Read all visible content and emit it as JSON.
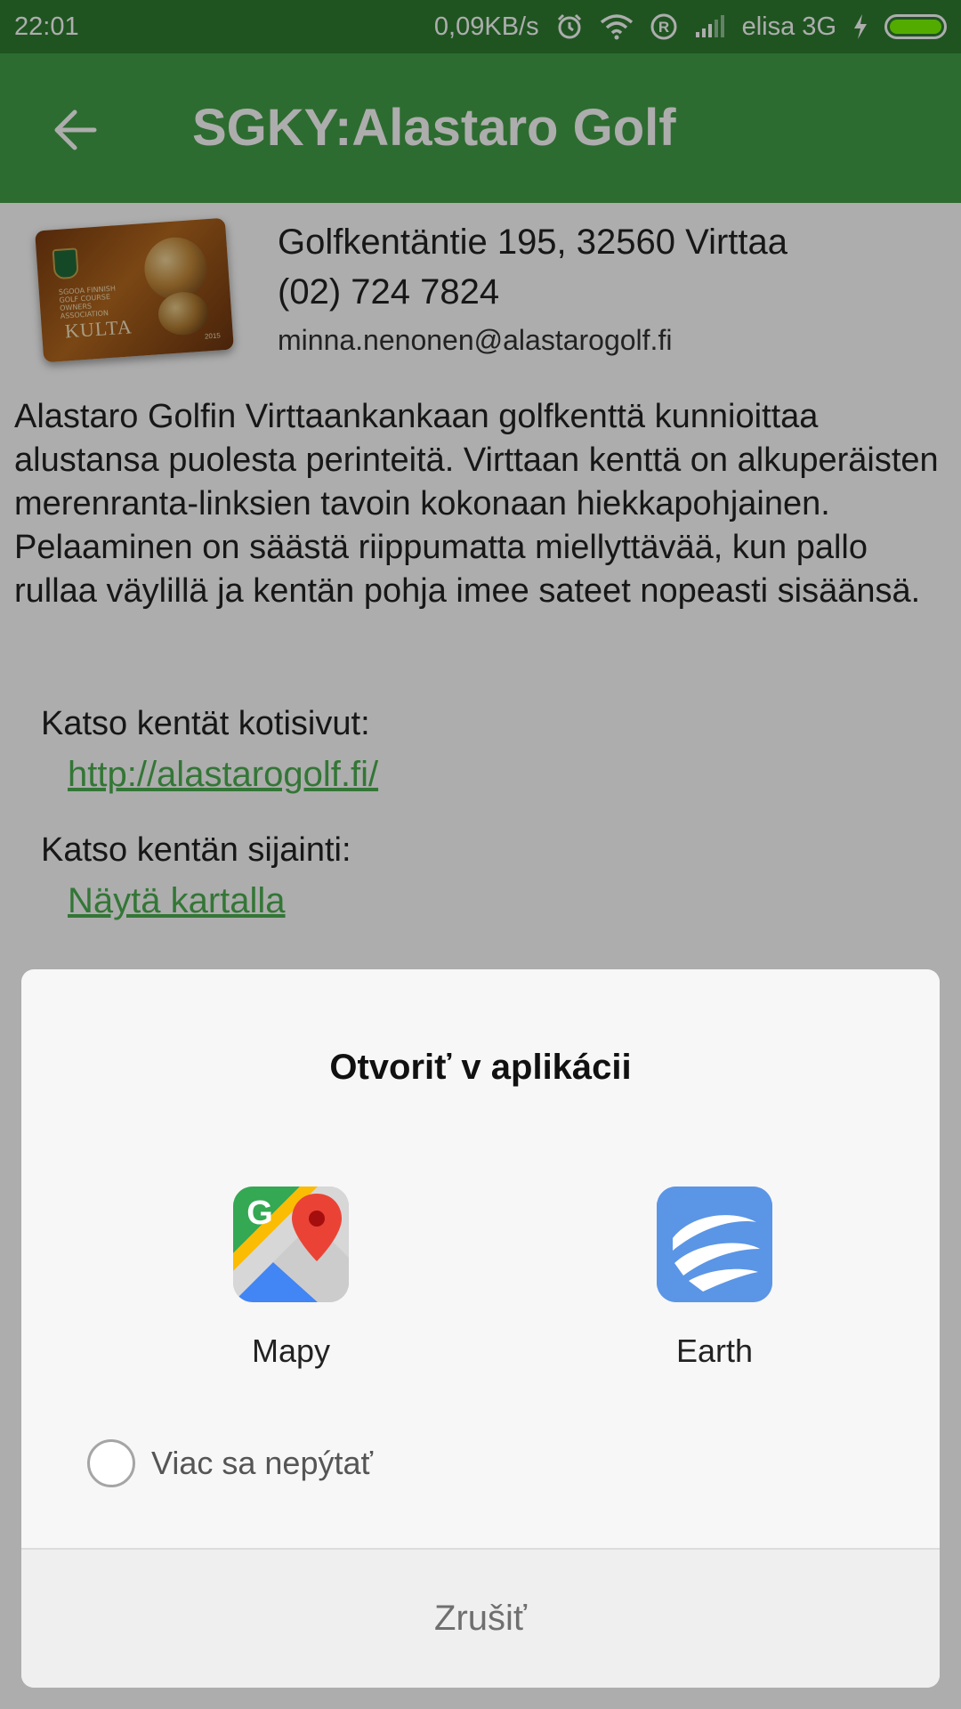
{
  "status_bar": {
    "time": "22:01",
    "speed": "0,09KB/s",
    "carrier": "elisa 3G",
    "icons": [
      "alarm-icon",
      "wifi-icon",
      "roaming-icon",
      "signal-icon",
      "charging-icon",
      "battery-icon"
    ]
  },
  "app_bar": {
    "title": "SGKY:Alastaro Golf",
    "back_icon": "arrow-left-icon"
  },
  "course": {
    "card_text": {
      "association": "SGOOA FINNISH GOLF COURSE OWNERS ASSOCIATION",
      "brand": "KULTA",
      "year": "2015"
    },
    "address": "Golfkentäntie 195, 32560 Virttaa",
    "phone": "(02) 724 7824",
    "email": "minna.nenonen@alastarogolf.fi",
    "description": "Alastaro Golfin Virttaankankaan golfkenttä kunnioittaa alustansa puolesta perinteitä. Virttaan kenttä on alkuperäisten merenranta-linksien tavoin kokonaan hiekkapohjainen. Pelaaminen on säästä riippumatta miellyttävää, kun pallo rullaa väylillä ja kentän pohja imee sateet nopeasti sisäänsä.",
    "homepage_label": "Katso kentät kotisivut:",
    "homepage_link": "http://alastarogolf.fi/",
    "location_label": "Katso kentän sijainti:",
    "location_link": "Näytä kartalla"
  },
  "dialog": {
    "title": "Otvoriť v aplikácii",
    "apps": [
      {
        "label": "Mapy",
        "icon": "google-maps-icon"
      },
      {
        "label": "Earth",
        "icon": "google-earth-icon"
      }
    ],
    "dont_ask_label": "Viac sa nepýtať",
    "dont_ask_checked": false,
    "cancel_label": "Zrušiť"
  },
  "colors": {
    "status_bar": "#2e7d32",
    "app_bar": "#43a047",
    "link": "#4caf50",
    "dialog_bg": "#f7f7f7"
  }
}
